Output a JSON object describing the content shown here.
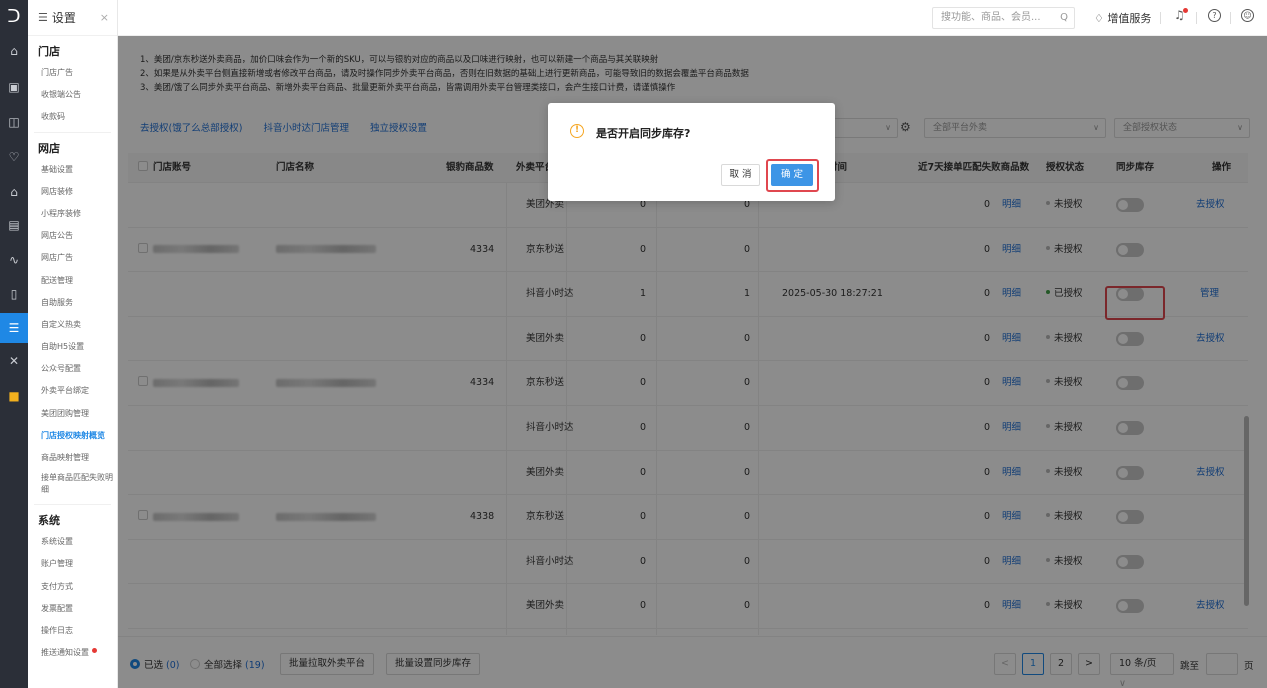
{
  "rail": {
    "logo": "ᑐ",
    "icons": [
      "home-icon",
      "monitor-icon",
      "calendar-icon",
      "heart-icon",
      "bank-icon",
      "card-icon",
      "chart-icon",
      "document-icon",
      "settings-list-icon",
      "tools-icon",
      "apps-icon"
    ]
  },
  "sidebar": {
    "title": "设置",
    "close": "×",
    "groups": [
      {
        "label": "门店",
        "items": [
          "门店广告",
          "收银端公告",
          "收款码"
        ]
      },
      {
        "label": "网店",
        "items": [
          "基础设置",
          "网店装修",
          "小程序装修",
          "网店公告",
          "网店广告",
          "配送管理",
          "自助服务",
          "自定义热卖",
          "自助H5设置",
          "公众号配置",
          "外卖平台绑定",
          "美团团购管理",
          "门店授权映射概览",
          "商品映射管理",
          "接单商品匹配失败明细"
        ]
      },
      {
        "label": "系统",
        "items": [
          "系统设置",
          "账户管理",
          "支付方式",
          "发票配置",
          "操作日志",
          "推送通知设置"
        ]
      }
    ],
    "active_item": "门店授权映射概览"
  },
  "topbar": {
    "search_placeholder": "搜功能、商品、会员...",
    "search_icon": "Q",
    "vip_label": "增值服务"
  },
  "notices": [
    "1、美团/京东秒送外卖商品，加价口味会作为一个新的SKU，可以与银豹对应的商品以及口味进行映射，也可以新建一个商品与其关联映射",
    "2、如果是从外卖平台侧直接新增或者修改平台商品，请及时操作同步外卖平台商品，否则在旧数据的基础上进行更新商品，可能导致旧的数据会覆盖平台商品数据",
    "3、美团/饿了么同步外卖平台商品、新增外卖平台商品、批量更新外卖平台商品，皆需调用外卖平台管理类接口，会产生接口计费，请谨慎操作"
  ],
  "links": [
    "去授权(饿了么总部授权)",
    "抖音小时达门店管理",
    "独立授权设置"
  ],
  "filters": {
    "platform": "全部平台外卖",
    "auth": "全部授权状态"
  },
  "table": {
    "headers": [
      "门店账号",
      "门店名称",
      "银豹商品数",
      "外卖平台",
      "",
      "",
      "最后同步时间",
      "近7天接单匹配失败商品数",
      "授权状态",
      "同步库存",
      "操作"
    ],
    "visible_header_fragment": "时间",
    "detail_label": "明细",
    "rows": [
      {
        "platform": "美团外卖",
        "c1": "0",
        "c2": "0",
        "time": "",
        "fail": "0",
        "auth": "未授权",
        "authorized": false,
        "action": "去授权",
        "store_count": ""
      },
      {
        "platform": "京东秒送",
        "c1": "0",
        "c2": "0",
        "time": "",
        "fail": "0",
        "auth": "未授权",
        "authorized": false,
        "action": "",
        "store_count": "4334"
      },
      {
        "platform": "抖音小时达",
        "c1": "1",
        "c2": "1",
        "time": "2025-05-30 18:27:21",
        "fail": "0",
        "auth": "已授权",
        "authorized": true,
        "action": "管理",
        "store_count": ""
      },
      {
        "platform": "美团外卖",
        "c1": "0",
        "c2": "0",
        "time": "",
        "fail": "0",
        "auth": "未授权",
        "authorized": false,
        "action": "去授权",
        "store_count": ""
      },
      {
        "platform": "京东秒送",
        "c1": "0",
        "c2": "0",
        "time": "",
        "fail": "0",
        "auth": "未授权",
        "authorized": false,
        "action": "",
        "store_count": "4334"
      },
      {
        "platform": "抖音小时达",
        "c1": "0",
        "c2": "0",
        "time": "",
        "fail": "0",
        "auth": "未授权",
        "authorized": false,
        "action": "",
        "store_count": ""
      },
      {
        "platform": "美团外卖",
        "c1": "0",
        "c2": "0",
        "time": "",
        "fail": "0",
        "auth": "未授权",
        "authorized": false,
        "action": "去授权",
        "store_count": ""
      },
      {
        "platform": "京东秒送",
        "c1": "0",
        "c2": "0",
        "time": "",
        "fail": "0",
        "auth": "未授权",
        "authorized": false,
        "action": "",
        "store_count": "4338"
      },
      {
        "platform": "抖音小时达",
        "c1": "0",
        "c2": "0",
        "time": "",
        "fail": "0",
        "auth": "未授权",
        "authorized": false,
        "action": "",
        "store_count": ""
      },
      {
        "platform": "美团外卖",
        "c1": "0",
        "c2": "0",
        "time": "",
        "fail": "0",
        "auth": "未授权",
        "authorized": false,
        "action": "去授权",
        "store_count": ""
      }
    ]
  },
  "footer": {
    "selected_label": "已选",
    "selected_count": "(0)",
    "select_all_label": "全部选择",
    "select_all_count": "(19)",
    "btn_pull": "批量拉取外卖平台",
    "btn_sync": "批量设置同步库存",
    "prev": "<",
    "page1": "1",
    "page2": "2",
    "next": ">",
    "page_size": "10 条/页",
    "goto_label": "跳至",
    "page_unit": "页"
  },
  "dialog": {
    "message": "是否开启同步库存?",
    "cancel": "取 消",
    "confirm": "确 定"
  }
}
